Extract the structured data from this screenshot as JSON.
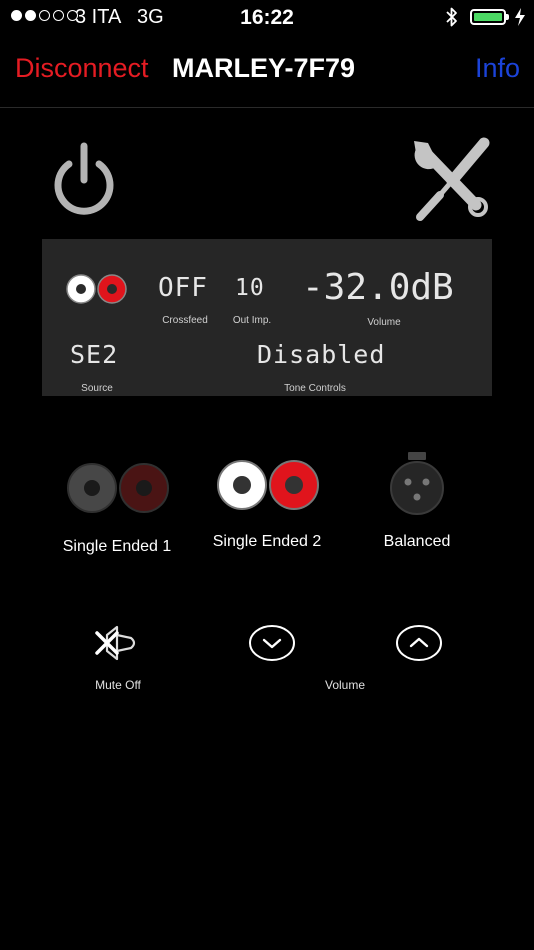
{
  "status_bar": {
    "carrier": "3 ITA",
    "network": "3G",
    "time": "16:22",
    "signal_bars_filled": 2,
    "signal_bars_total": 5,
    "battery_level": 1.0,
    "battery_color": "#4cd964"
  },
  "nav": {
    "disconnect_label": "Disconnect",
    "device_name": "MARLEY-7F79",
    "info_label": "Info",
    "disconnect_color": "#e51c23",
    "info_color": "#1b43d9"
  },
  "icons": {
    "power": "power-icon",
    "settings": "wrench-screwdriver-icon"
  },
  "display": {
    "crossfeed_value": "OFF",
    "crossfeed_label": "Crossfeed",
    "out_imp_value": "10",
    "out_imp_label": "Out Imp.",
    "volume_value": "-32.0dB",
    "volume_label": "Volume",
    "source_value": "SE2",
    "source_label": "Source",
    "tone_value": "Disabled",
    "tone_label": "Tone Controls"
  },
  "outputs": [
    {
      "label": "Single Ended 1",
      "active": false
    },
    {
      "label": "Single Ended 2",
      "active": true
    },
    {
      "label": "Balanced",
      "active": false
    }
  ],
  "controls": {
    "mute_label": "Mute Off",
    "volume_label": "Volume"
  }
}
